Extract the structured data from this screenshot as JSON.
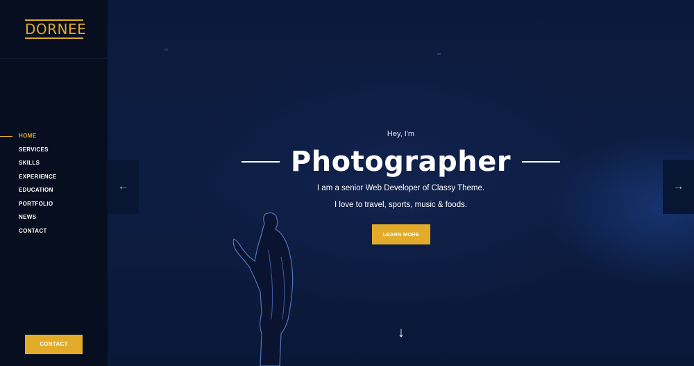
{
  "sidebar": {
    "logo": "DORNEE",
    "nav": [
      {
        "label": "HOME",
        "active": true
      },
      {
        "label": "SERVICES"
      },
      {
        "label": "SKILLS"
      },
      {
        "label": "EXPERIENCE"
      },
      {
        "label": "EDUCATION"
      },
      {
        "label": "PORTFOLIO"
      },
      {
        "label": "NEWS"
      },
      {
        "label": "CONTACT"
      }
    ],
    "contact_button": "CONTACT"
  },
  "hero": {
    "greeting": "Hey, I'm",
    "title": "Photographer",
    "line1": "I am a senior Web Developer of Classy Theme.",
    "line2": "I love to travel, sports, music & foods.",
    "button": "LEARN MORE",
    "prev_icon": "←",
    "next_icon": "→",
    "scroll_icon": "↓"
  },
  "colors": {
    "accent": "#e2ab2a",
    "sidebar_bg": "#070e1f",
    "hero_bg": "#0b1a3d"
  }
}
